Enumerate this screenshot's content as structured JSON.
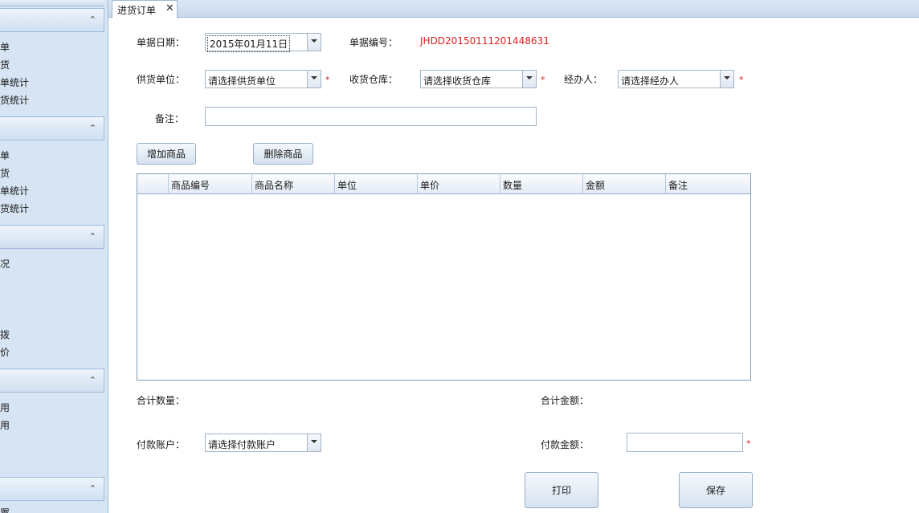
{
  "sidebar": {
    "groups": [
      {
        "items": [
          "单",
          "货",
          "单统计",
          "货统计"
        ]
      },
      {
        "items": [
          "单",
          "货",
          "单统计",
          "货统计"
        ]
      },
      {
        "items": [
          "况",
          "拨",
          "价"
        ]
      },
      {
        "items": [
          "用",
          "用"
        ]
      },
      {
        "items": [
          "置"
        ]
      }
    ],
    "chevron": "⌃"
  },
  "tab": {
    "label": "进货订单",
    "close": "✕"
  },
  "form": {
    "date_label": "单据日期：",
    "date_value": "2015年01月11日",
    "docno_label": "单据编号：",
    "docno_value": "JHDD20150111201448631",
    "supplier_label": "供货单位：",
    "supplier_value": "请选择供货单位",
    "warehouse_label": "收货仓库：",
    "warehouse_value": "请选择收货仓库",
    "handler_label": "经办人：",
    "handler_value": "请选择经办人",
    "remark_label": "备注：",
    "remark_value": "",
    "required_mark": "*"
  },
  "buttons": {
    "add": "增加商品",
    "delete": "删除商品",
    "print": "打印",
    "save": "保存"
  },
  "table": {
    "columns": [
      "商品编号",
      "商品名称",
      "单位",
      "单价",
      "数量",
      "金额",
      "备注"
    ],
    "rows": []
  },
  "summary": {
    "total_qty_label": "合计数量：",
    "total_amount_label": "合计金额：",
    "account_label": "付款账户：",
    "account_value": "请选择付款账户",
    "pay_amount_label": "付款金额：",
    "pay_amount_value": ""
  },
  "colors": {
    "required": "#e02020",
    "docno": "#e02020",
    "sidebar": "#d6e4f3"
  }
}
